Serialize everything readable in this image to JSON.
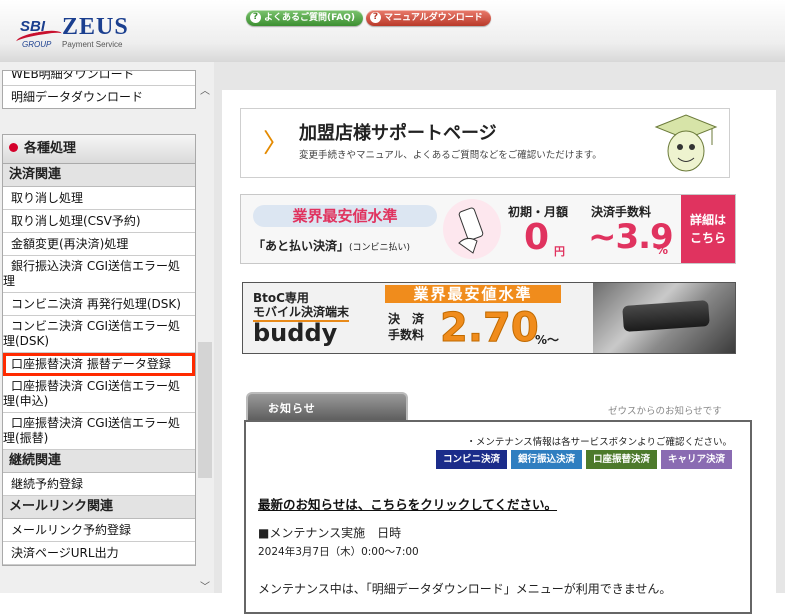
{
  "header": {
    "logo": {
      "sbi": "SBI",
      "zeus": "ZEUS",
      "group": "GROUP",
      "payment": "Payment Service"
    },
    "faq_button": "よくあるご質問(FAQ)",
    "manual_button": "マニュアルダウンロード"
  },
  "sidebar": {
    "top_items": [
      "WEB明細ダウンロード",
      "明細データダウンロード"
    ],
    "section_title": "各種処理",
    "groups": [
      {
        "category": "決済関連",
        "items": [
          {
            "label": "取り消し処理"
          },
          {
            "label": "取り消し処理(CSV予約)"
          },
          {
            "label": "金額変更(再決済)処理"
          },
          {
            "label": "銀行振込決済 CGI送信エラー処",
            "label_2": "理"
          },
          {
            "label": "コンビニ決済 再発行処理(DSK)"
          },
          {
            "label": "コンビニ決済 CGI送信エラー処",
            "label_2": "理(DSK)"
          },
          {
            "label": "口座振替決済 振替データ登録"
          },
          {
            "label": "口座振替決済 CGI送信エラー処",
            "label_2": "理(申込)"
          },
          {
            "label": "口座振替決済 CGI送信エラー処",
            "label_2": "理(振替)"
          }
        ]
      },
      {
        "category": "継続関連",
        "items": [
          {
            "label": "継続予約登録"
          }
        ]
      },
      {
        "category": "メールリンク関連",
        "items": [
          {
            "label": "メールリンク予約登録"
          },
          {
            "label": "決済ページURL出力"
          }
        ]
      }
    ]
  },
  "banners": {
    "support": {
      "title": "加盟店様サポートページ",
      "subtitle": "変更手続きやマニュアル、よくあるご質問などをご確認いただけます。"
    },
    "atobarai": {
      "tag": "業界最安値水準",
      "sub": "「あと払い決済」",
      "sub_small": "(コンビニ払い)",
      "label1": "初期・月額",
      "label2": "決済手数料",
      "zero": "0",
      "en": "円",
      "pct": "~3.9",
      "pct_sign": "%",
      "detail1": "詳細は",
      "detail2": "こちら"
    },
    "buddy": {
      "btoc": "BtoC専用",
      "mobile": "モバイル決済端末",
      "name": "buddy",
      "tag": "業界最安値水準",
      "fee_label1": "決　済",
      "fee_label2": "手数料",
      "rate": "2.70",
      "pct": "%～"
    }
  },
  "news": {
    "tab": "お知らせ",
    "from": "ゼウスからのお知らせです",
    "maintenance_note": "・メンテナンス情報は各サービスボタンよりご確認ください。",
    "buttons": [
      {
        "label": "コンビニ決済",
        "color": "#1b2c8a"
      },
      {
        "label": "銀行振込決済",
        "color": "#2f7ec0"
      },
      {
        "label": "口座振替決済",
        "color": "#4d7a2b"
      },
      {
        "label": "キャリア決済",
        "color": "#8a6bb2"
      }
    ],
    "latest_link": "最新のお知らせは、こちらをクリックしてください。",
    "item_title": "■メンテナンス実施　日時",
    "item_date": "2024年3月7日（木）0:00～7:00",
    "item_body": "メンテナンス中は、「明細データダウンロード」メニューが利用できません。"
  }
}
